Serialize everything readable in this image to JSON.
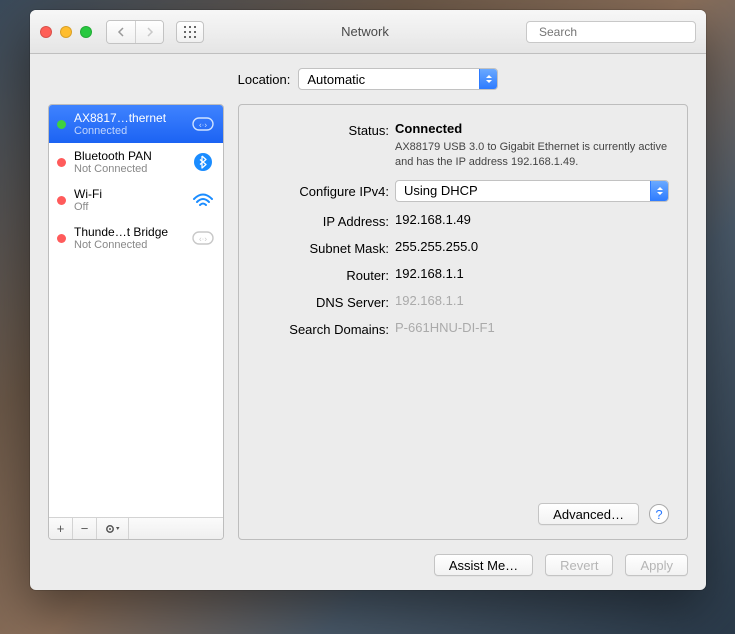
{
  "window": {
    "title": "Network",
    "search_placeholder": "Search"
  },
  "location": {
    "label": "Location:",
    "value": "Automatic"
  },
  "sidebar": {
    "items": [
      {
        "name": "AX8817…thernet",
        "status": "Connected",
        "dot": "green",
        "icon": "ethernet",
        "selected": true
      },
      {
        "name": "Bluetooth PAN",
        "status": "Not Connected",
        "dot": "red",
        "icon": "bluetooth",
        "selected": false
      },
      {
        "name": "Wi-Fi",
        "status": "Off",
        "dot": "red",
        "icon": "wifi",
        "selected": false
      },
      {
        "name": "Thunde…t Bridge",
        "status": "Not Connected",
        "dot": "red",
        "icon": "ethernet-dim",
        "selected": false
      }
    ]
  },
  "detail": {
    "status_label": "Status:",
    "status_value": "Connected",
    "status_desc": "AX88179 USB 3.0 to Gigabit Ethernet is currently active and has the IP address 192.168.1.49.",
    "configure_label": "Configure IPv4:",
    "configure_value": "Using DHCP",
    "ip_label": "IP Address:",
    "ip_value": "192.168.1.49",
    "subnet_label": "Subnet Mask:",
    "subnet_value": "255.255.255.0",
    "router_label": "Router:",
    "router_value": "192.168.1.1",
    "dns_label": "DNS Server:",
    "dns_value": "192.168.1.1",
    "search_label": "Search Domains:",
    "search_value": "P-661HNU-DI-F1",
    "advanced_btn": "Advanced…"
  },
  "footer": {
    "assist": "Assist Me…",
    "revert": "Revert",
    "apply": "Apply"
  }
}
